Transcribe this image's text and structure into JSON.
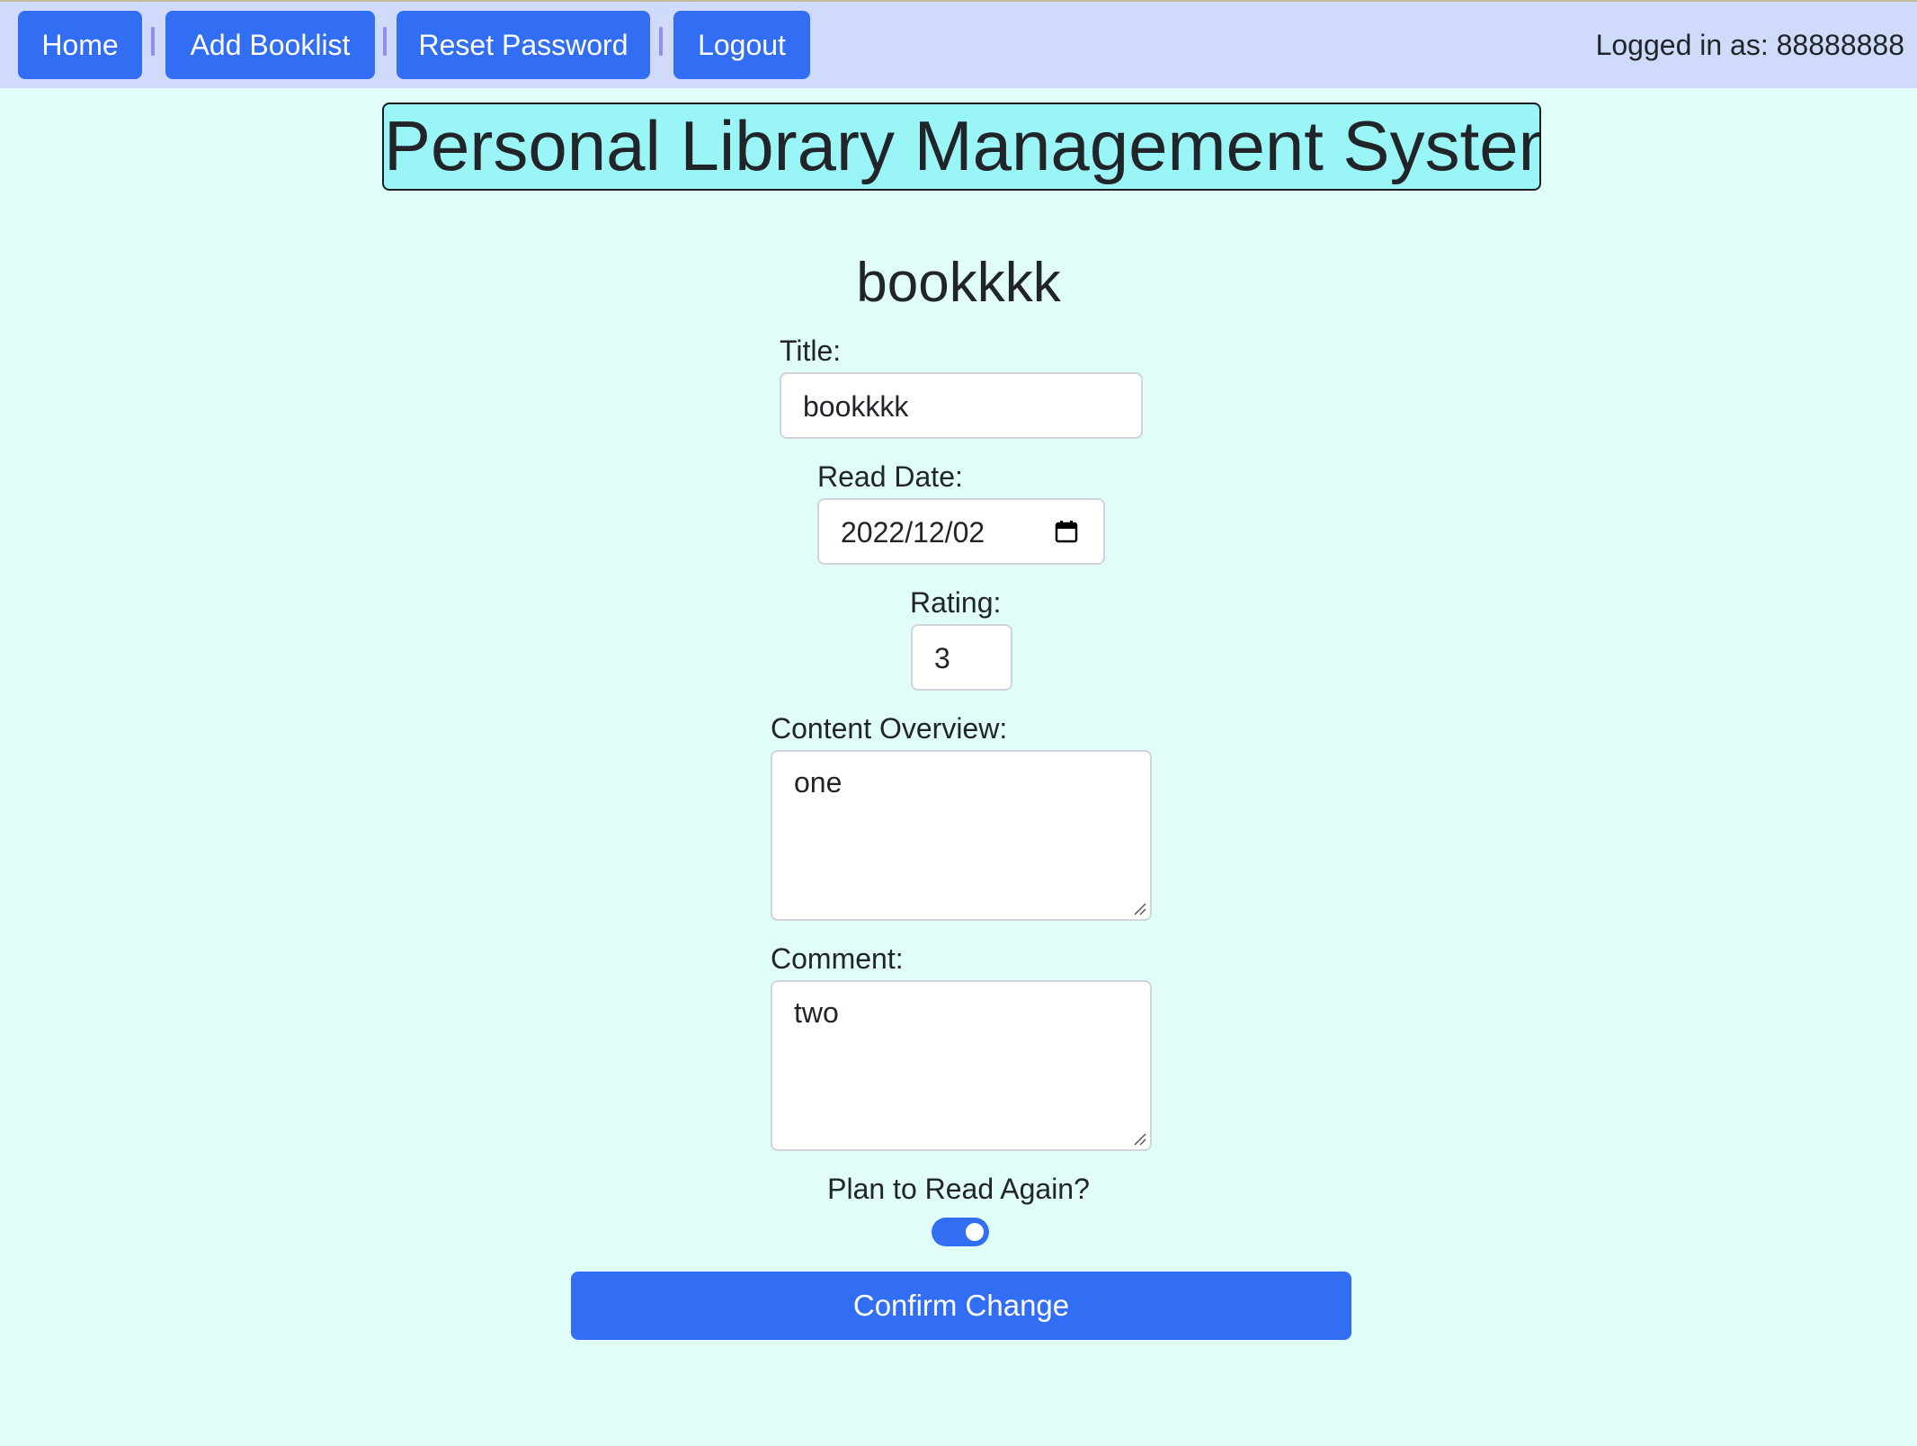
{
  "nav": {
    "home_label": "Home",
    "add_booklist_label": "Add Booklist",
    "reset_password_label": "Reset Password",
    "logout_label": "Logout",
    "logged_in_text": "Logged in as: 88888888"
  },
  "page_title": "Personal Library Management System",
  "book_heading": "bookkkk",
  "form": {
    "title_label": "Title:",
    "title_value": "bookkkk",
    "read_date_label": "Read Date:",
    "read_date_value": "2022/12/02",
    "rating_label": "Rating:",
    "rating_value": "3",
    "content_overview_label": "Content Overview:",
    "content_overview_value": "one",
    "comment_label": "Comment:",
    "comment_value": "two",
    "plan_to_read_again_label": "Plan to Read Again?",
    "plan_to_read_again_checked": true,
    "confirm_label": "Confirm Change"
  },
  "colors": {
    "page_background": "#e0fdf9",
    "navbar_background": "#d0dbfb",
    "button_primary": "#316ef4",
    "title_box_background": "#9af6f6",
    "nav_separator": "#8f8ff0"
  },
  "icons": {
    "date_picker": "calendar-icon",
    "textarea_resize": "resize-handle-icon"
  }
}
